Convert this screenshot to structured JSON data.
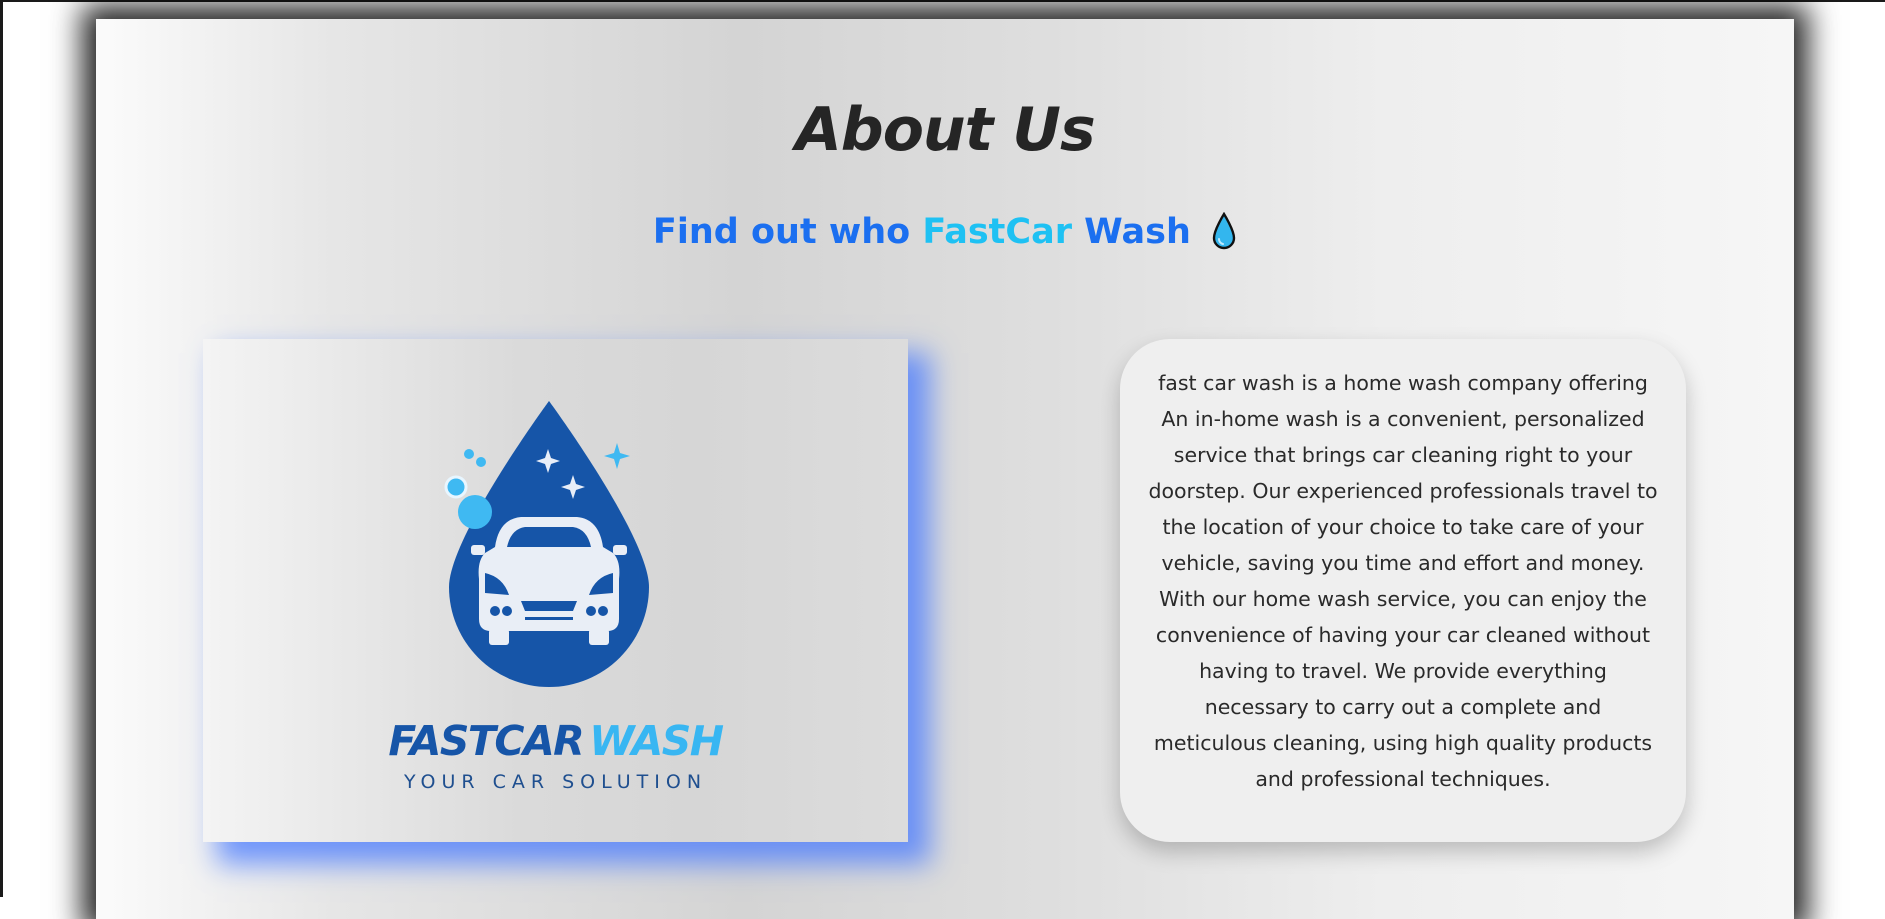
{
  "section": {
    "title": "About Us",
    "subtitle_prefix": "Find out who",
    "subtitle_brand": "FastCar",
    "subtitle_suffix": "Wash",
    "subtitle_icon": "water-drop-icon"
  },
  "logo": {
    "word_left": "FASTCAR",
    "word_right": "WASH",
    "tagline": "YOUR CAR SOLUTION",
    "icon": "car-in-water-drop-icon"
  },
  "about": {
    "text": "fast car wash is a home wash company offering An in-home wash is a convenient, personalized service that brings car cleaning right to your doorstep. Our experienced professionals travel to the location of your choice to take care of your vehicle, saving you time and effort and money. With our home wash service, you can enjoy the convenience of having your car cleaned without having to travel. We provide everything necessary to carry out a complete and meticulous cleaning, using high quality products and professional techniques."
  },
  "colors": {
    "accent_blue": "#1b6ff0",
    "brand_cyan": "#1ec1f3",
    "logo_navy": "#1655a8",
    "glow_blue": "#4678ff"
  }
}
